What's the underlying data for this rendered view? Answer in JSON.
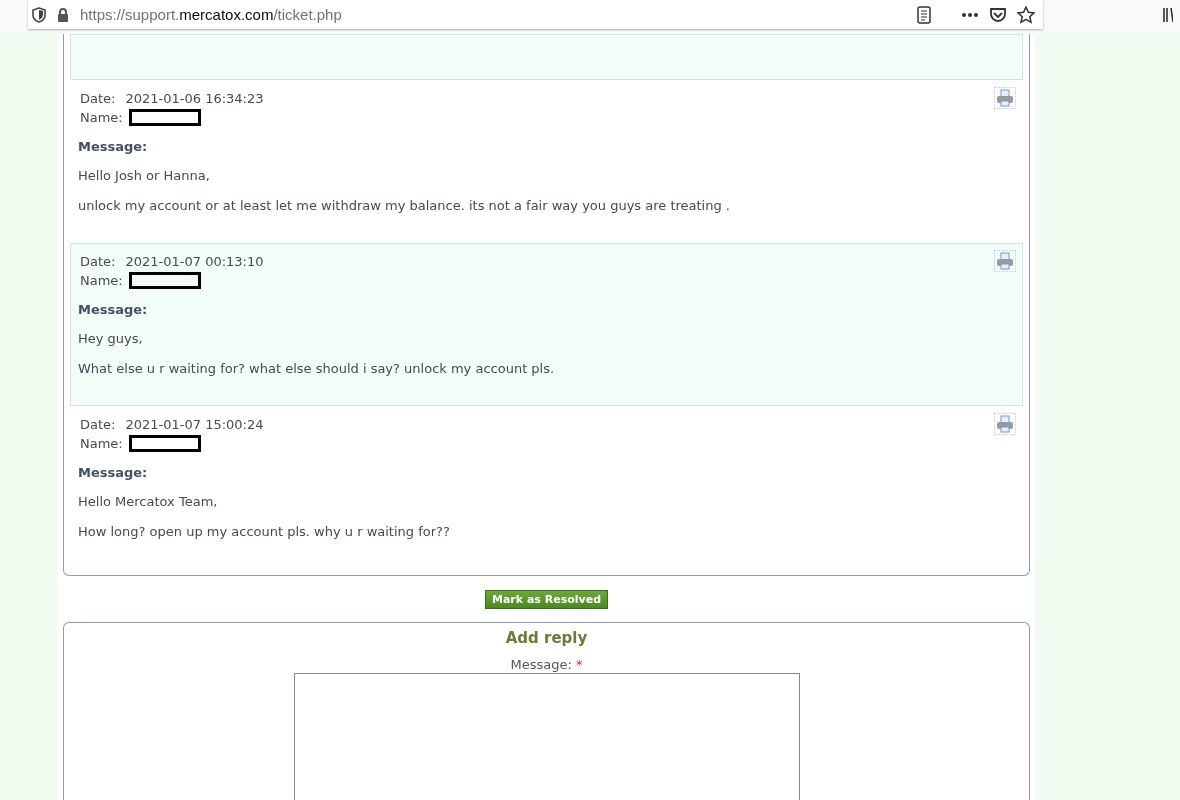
{
  "browser": {
    "url_prefix": "https://support.",
    "url_domain": "mercatox.com",
    "url_path": "/ticket.php"
  },
  "entries": [
    {
      "highlighted": true
    },
    {
      "highlighted": false,
      "date_label": "Date:",
      "date": "2021-01-06 16:34:23",
      "name_label": "Name:",
      "message_label": "Message:",
      "paragraphs": [
        "Hello Josh or Hanna,",
        "unlock my account or at least let me withdraw my balance. its not a fair way you guys are treating ."
      ]
    },
    {
      "highlighted": true,
      "date_label": "Date:",
      "date": "2021-01-07 00:13:10",
      "name_label": "Name:",
      "message_label": "Message:",
      "paragraphs": [
        "Hey guys,",
        "What else u r waiting for? what else should i say? unlock my account pls."
      ]
    },
    {
      "highlighted": false,
      "date_label": "Date:",
      "date": "2021-01-07 15:00:24",
      "name_label": "Name:",
      "message_label": "Message:",
      "paragraphs": [
        "Hello Mercatox Team,",
        "How long? open up my account pls. why u r waiting for??"
      ]
    }
  ],
  "resolve_button": "Mark as Resolved",
  "reply": {
    "title": "Add reply",
    "message_label": "Message:",
    "required_mark": "*"
  }
}
